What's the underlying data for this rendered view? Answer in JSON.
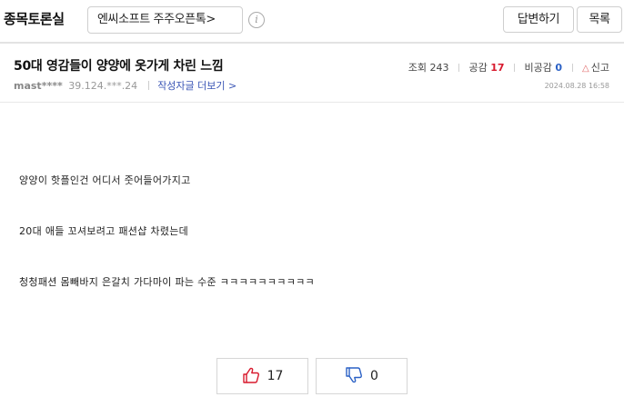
{
  "header": {
    "board_title": "종목토론실",
    "stock_name": "엔씨소프트 주주오픈톡>",
    "info_icon": "i",
    "reply_label": "답변하기",
    "list_label": "목록"
  },
  "post": {
    "title": "50대 영감들이 양양에 옷가게 차린 느낌",
    "author": "mast****",
    "ip": "39.124.***.24",
    "more_posts_label": "작성자글 더보기 >",
    "views_label": "조회",
    "views": "243",
    "likes_label": "공감",
    "likes": "17",
    "dislikes_label": "비공감",
    "dislikes": "0",
    "report_icon": "△",
    "report_label": "신고",
    "date": "2024.08.28 16:58"
  },
  "content": {
    "lines": [
      "양양이 핫플인건 어디서 줏어들어가지고",
      "20대 애들 꼬셔보려고 패션샵 차렸는데",
      "청청패션 몸빼바지 은갈치 가다마이 파는 수준 ㅋㅋㅋㅋㅋㅋㅋㅋㅋㅋ"
    ]
  },
  "votes": {
    "up_count": "17",
    "down_count": "0"
  },
  "icons": {
    "thumbs_up": "thumbs-up-icon",
    "thumbs_down": "thumbs-down-icon",
    "info": "info-icon",
    "report": "report-icon"
  },
  "colors": {
    "like": "#d8192d",
    "dislike": "#2b61c5",
    "link": "#3a55b5"
  }
}
